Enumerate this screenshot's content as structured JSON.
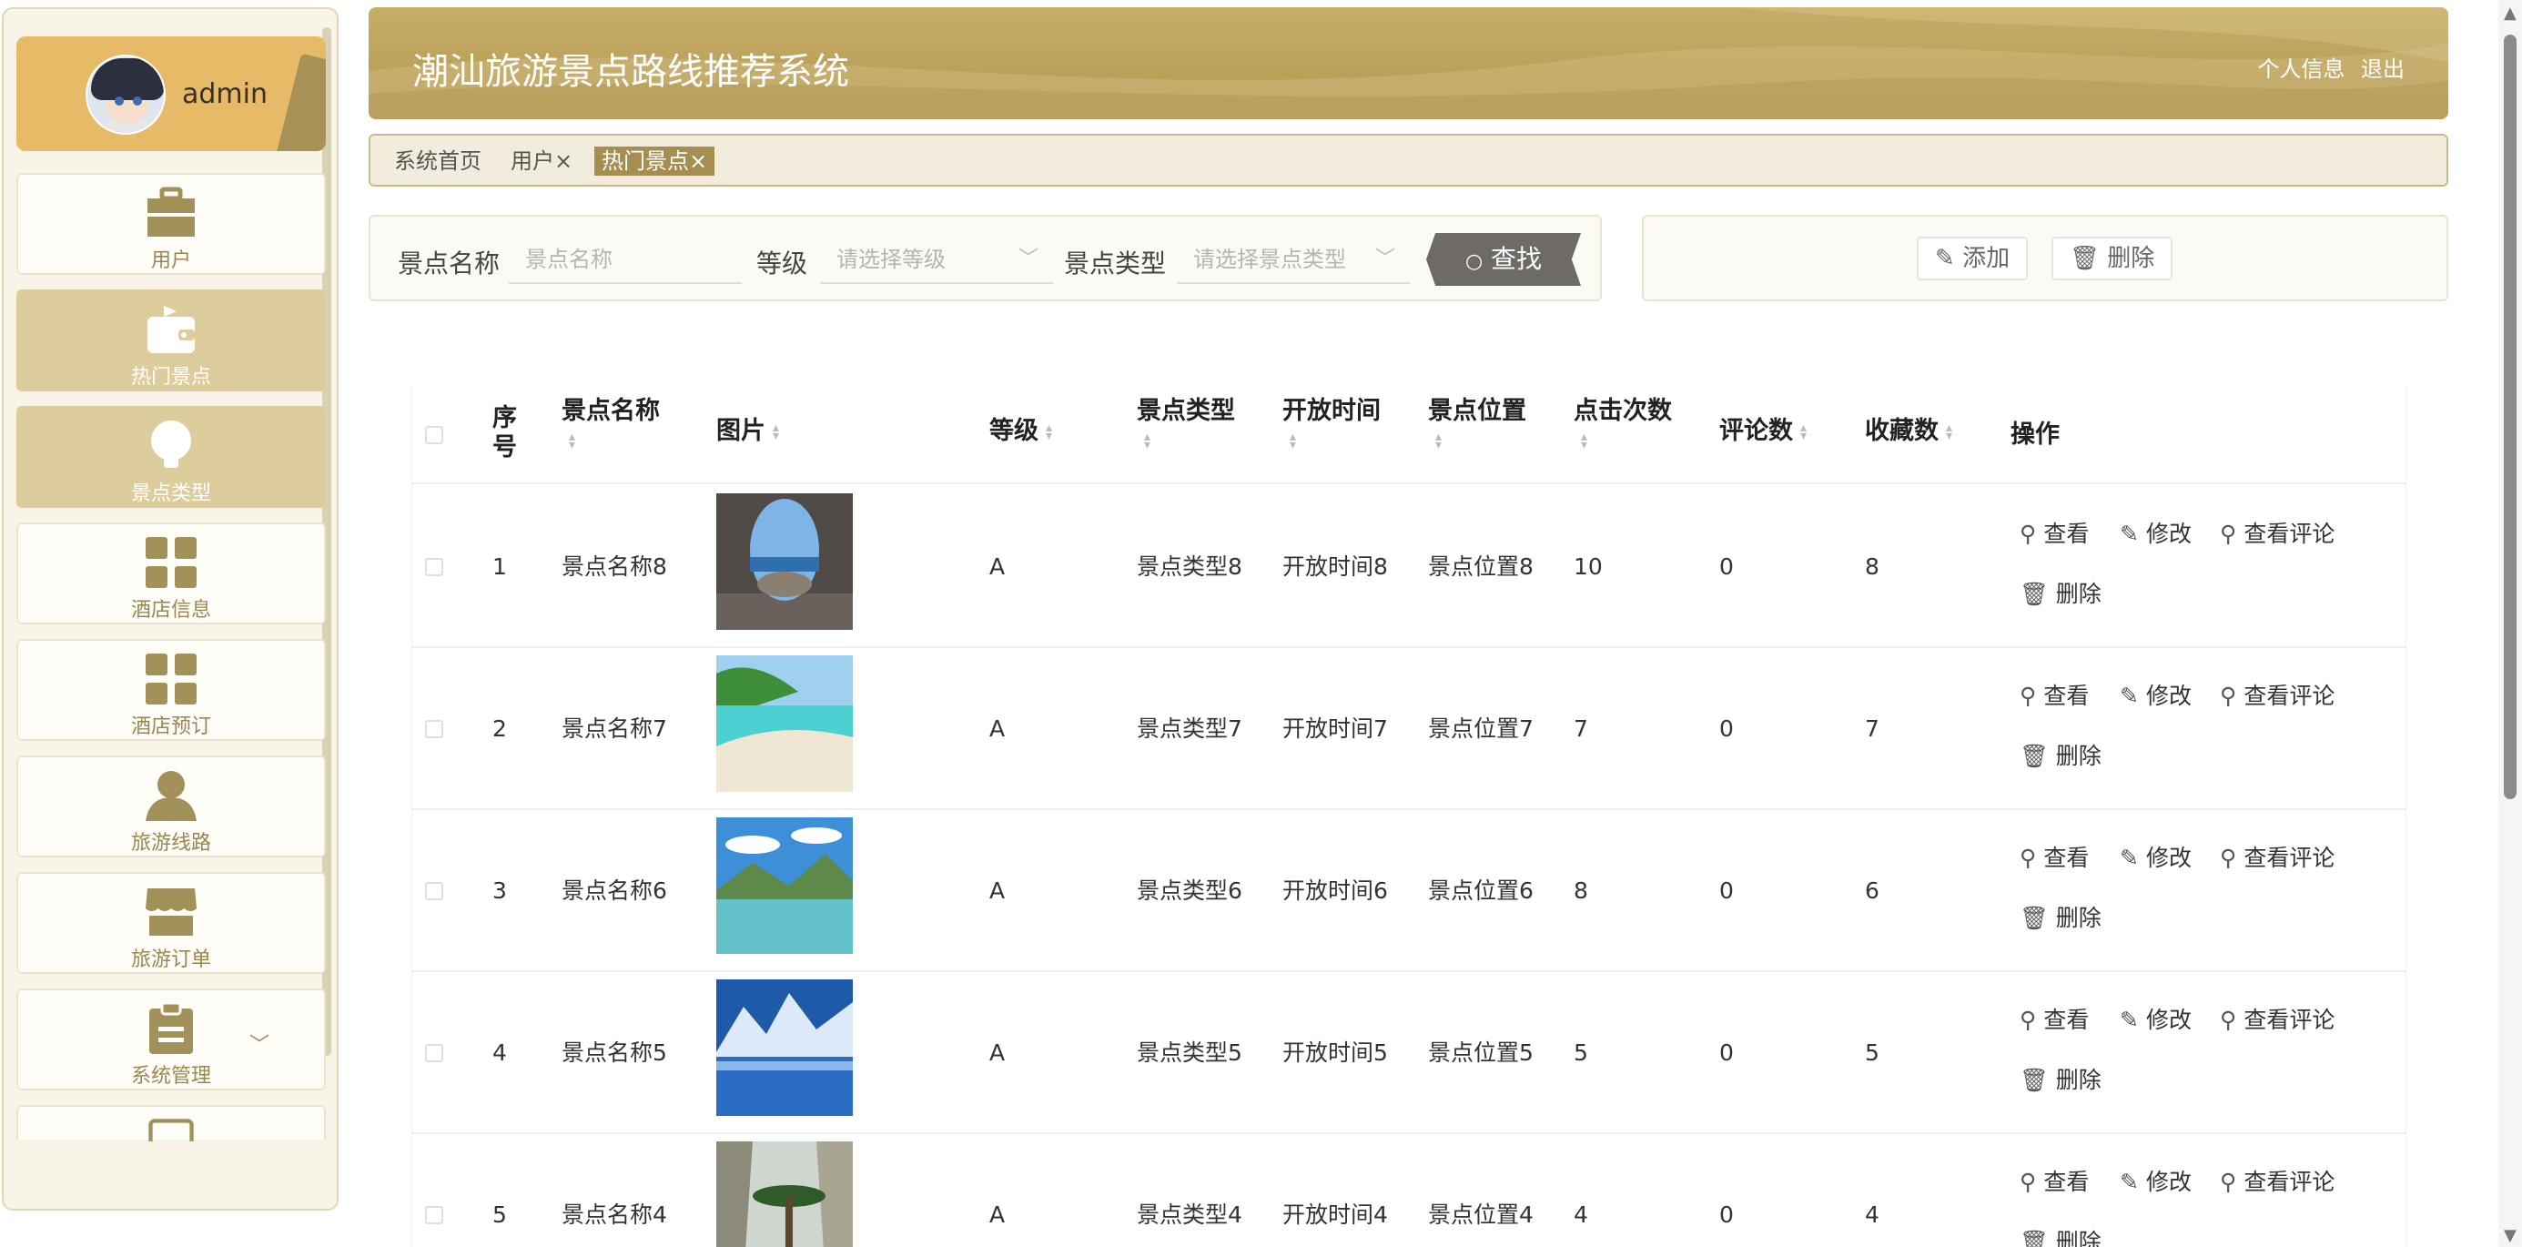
{
  "sidebar": {
    "username": "admin",
    "items": [
      {
        "label": "用户",
        "icon": "briefcase-icon",
        "active": false
      },
      {
        "label": "热门景点",
        "icon": "wallet-icon",
        "active": true
      },
      {
        "label": "景点类型",
        "icon": "bulb-icon",
        "active": true
      },
      {
        "label": "酒店信息",
        "icon": "grid-icon",
        "active": false
      },
      {
        "label": "酒店预订",
        "icon": "grid-icon",
        "active": false
      },
      {
        "label": "旅游线路",
        "icon": "person-icon",
        "active": false
      },
      {
        "label": "旅游订单",
        "icon": "shop-icon",
        "active": false
      },
      {
        "label": "系统管理",
        "icon": "clipboard-icon",
        "active": false
      }
    ]
  },
  "header": {
    "title": "潮汕旅游景点路线推荐系统",
    "profile_link": "个人信息",
    "logout_link": "退出"
  },
  "tabs": [
    {
      "label": "系统首页",
      "closable": false,
      "active": false
    },
    {
      "label": "用户×",
      "closable": true,
      "active": false
    },
    {
      "label": "热门景点×",
      "closable": true,
      "active": true
    }
  ],
  "search": {
    "name_label": "景点名称",
    "name_placeholder": "景点名称",
    "level_label": "等级",
    "level_placeholder": "请选择等级",
    "type_label": "景点类型",
    "type_placeholder": "请选择景点类型",
    "find_button": "查找"
  },
  "actions": {
    "add_button": "添加",
    "delete_button": "删除"
  },
  "table": {
    "headers": {
      "index_1": "序",
      "index_2": "号",
      "name": "景点名称",
      "image": "图片",
      "level": "等级",
      "type": "景点类型",
      "open_time": "开放时间",
      "location": "景点位置",
      "clicks": "点击次数",
      "comments": "评论数",
      "favorites": "收藏数",
      "ops": "操作"
    },
    "op_labels": {
      "view": "查看",
      "edit": "修改",
      "view_comments": "查看评论",
      "delete": "删除"
    },
    "rows": [
      {
        "index": "1",
        "name": "景点名称8",
        "level": "A",
        "type": "景点类型8",
        "open_time": "开放时间8",
        "location": "景点位置8",
        "clicks": "10",
        "comments": "0",
        "favorites": "8",
        "image": "cave-arch"
      },
      {
        "index": "2",
        "name": "景点名称7",
        "level": "A",
        "type": "景点类型7",
        "open_time": "开放时间7",
        "location": "景点位置7",
        "clicks": "7",
        "comments": "0",
        "favorites": "7",
        "image": "beach"
      },
      {
        "index": "3",
        "name": "景点名称6",
        "level": "A",
        "type": "景点类型6",
        "open_time": "开放时间6",
        "location": "景点位置6",
        "clicks": "8",
        "comments": "0",
        "favorites": "6",
        "image": "lake-mountain"
      },
      {
        "index": "4",
        "name": "景点名称5",
        "level": "A",
        "type": "景点类型5",
        "open_time": "开放时间5",
        "location": "景点位置5",
        "clicks": "5",
        "comments": "0",
        "favorites": "5",
        "image": "snow-mountain"
      },
      {
        "index": "5",
        "name": "景点名称4",
        "level": "A",
        "type": "景点类型4",
        "open_time": "开放时间4",
        "location": "景点位置4",
        "clicks": "4",
        "comments": "0",
        "favorites": "4",
        "image": "pine-cliff"
      }
    ]
  },
  "colors": {
    "accent": "#a58e50",
    "header_gold": "#bba05a",
    "sidebar_active": "#ddcd9c",
    "user_card": "#e6ba66"
  }
}
